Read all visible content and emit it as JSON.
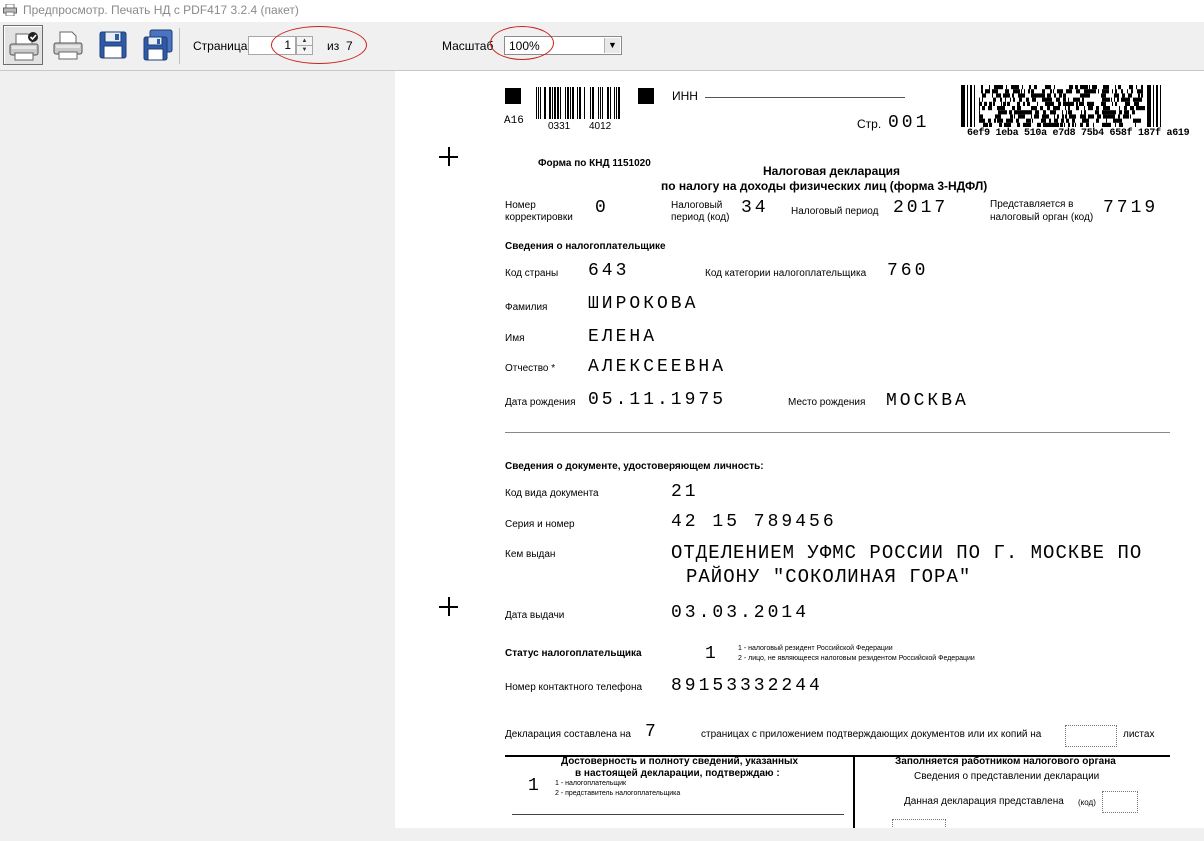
{
  "window": {
    "title": "Предпросмотр. Печать НД с PDF417 3.2.4 (пакет)"
  },
  "toolbar": {
    "buttons": [
      {
        "name": "print-settings-button",
        "icon": "printer-check-icon"
      },
      {
        "name": "print-button",
        "icon": "printer-icon"
      },
      {
        "name": "save-button",
        "icon": "floppy-disk-icon"
      },
      {
        "name": "save-all-button",
        "icon": "floppy-disks-icon"
      }
    ],
    "page_label": "Страница",
    "page_value": "1",
    "page_of_label": "из",
    "page_total": "7",
    "zoom_label": "Масштаб",
    "zoom_value": "100%"
  },
  "document": {
    "barcode_left_label": "A16",
    "barcode_left_number1": "0331",
    "barcode_left_number2": "4012",
    "inn_label": "ИНН",
    "page_label": "Стр.",
    "page_value": "001",
    "barcode_right_code": "6ef9 1eba 510a e7d8 75b4 658f 187f a619",
    "form_code": "Форма по КНД 1151020",
    "title_line1": "Налоговая декларация",
    "title_line2": "по налогу на доходы физических лиц (форма 3-НДФЛ)",
    "correction_label1": "Номер",
    "correction_label2": "корректировки",
    "correction_value": "0",
    "period_code_label1": "Налоговый",
    "period_code_label2": "период (код)",
    "period_code_value": "34",
    "tax_period_label": "Налоговый период",
    "tax_period_value": "2017",
    "tax_authority_label1": "Представляется в",
    "tax_authority_label2": "налоговый орган (код)",
    "tax_authority_value": "7719",
    "taxpayer_section": "Сведения о налогоплательщике",
    "country_label": "Код страны",
    "country_value": "643",
    "category_label": "Код категории налогоплательщика",
    "category_value": "760",
    "surname_label": "Фамилия",
    "surname_value": "ШИРОКОВА",
    "name_label": "Имя",
    "name_value": "ЕЛЕНА",
    "patronymic_label": "Отчество *",
    "patronymic_value": "АЛЕКСЕЕВНА",
    "birthdate_label": "Дата рождения",
    "birthdate_value": "05.11.1975",
    "birthplace_label": "Место рождения",
    "birthplace_value": "МОСКВА",
    "id_section": "Сведения о документе, удостоверяющем личность:",
    "doc_type_label": "Код вида документа",
    "doc_type_value": "21",
    "series_label": "Серия и номер",
    "series_value": "42 15 789456",
    "issued_by_label": "Кем выдан",
    "issued_by_line1": "ОТДЕЛЕНИЕМ УФМС РОССИИ ПО Г. МОСКВЕ ПО",
    "issued_by_line2": "РАЙОНУ \"СОКОЛИНАЯ ГОРА\"",
    "issue_date_label": "Дата выдачи",
    "issue_date_value": "03.03.2014",
    "status_label": "Статус налогоплательщика",
    "status_value": "1",
    "status_note1": "1 - налоговый резидент Российской Федерации",
    "status_note2": "2 - лицо, не являющееся налоговым резидентом Российской Федерации",
    "phone_label": "Номер контактного телефона",
    "phone_value": "89153332244",
    "composed_label": "Декларация составлена на",
    "composed_value": "7",
    "composed_mid": "страницах с приложением подтверждающих документов или их копий на",
    "composed_end": "листах",
    "confirm_title1": "Достоверность и полноту сведений, указанных",
    "confirm_title2": "в настоящей декларации, подтверждаю :",
    "confirm_value": "1",
    "confirm_note1": "1 - налогоплательщик",
    "confirm_note2": "2 - представитель налогоплательщика",
    "office_title": "Заполняется работником налогового органа",
    "office_sub": "Сведения о представлении декларации",
    "office_submitted": "Данная декларация представлена",
    "office_code": "(код)"
  }
}
